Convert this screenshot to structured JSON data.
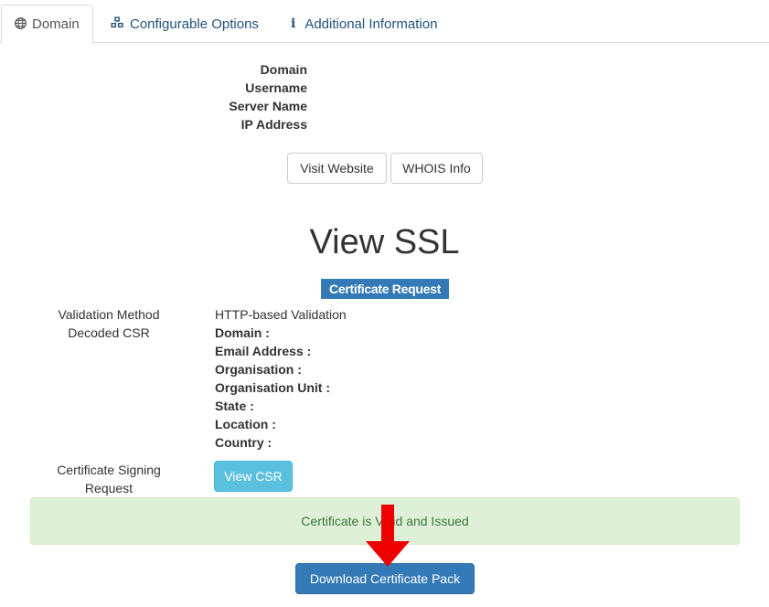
{
  "tabs": [
    {
      "label": "Domain",
      "icon": "globe-icon"
    },
    {
      "label": "Configurable Options",
      "icon": "cubes-icon"
    },
    {
      "label": "Additional Information",
      "icon": "info-icon"
    }
  ],
  "server_info": {
    "domain_label": "Domain",
    "username_label": "Username",
    "server_name_label": "Server Name",
    "ip_address_label": "IP Address"
  },
  "buttons": {
    "visit_website": "Visit Website",
    "whois_info": "WHOIS Info",
    "view_csr": "View CSR",
    "download_pack": "Download Certificate Pack"
  },
  "ssl": {
    "title": "View SSL",
    "badge": "Certificate Request",
    "validation_method_label": "Validation Method",
    "validation_method_value": "HTTP-based Validation",
    "decoded_csr_label": "Decoded CSR",
    "csr_fields": [
      "Domain :",
      "Email Address :",
      "Organisation :",
      "Organisation Unit :",
      "State :",
      "Location :",
      "Country :"
    ],
    "csr_signing_label_line1": "Certificate Signing",
    "csr_signing_label_line2": "Request"
  },
  "alert": {
    "message": "Certificate is Valid and Issued"
  },
  "colors": {
    "primary": "#337ab7",
    "info": "#5bc0de",
    "success_bg": "#dff0d8",
    "success_text": "#3c763d",
    "arrow": "#ee0000"
  }
}
